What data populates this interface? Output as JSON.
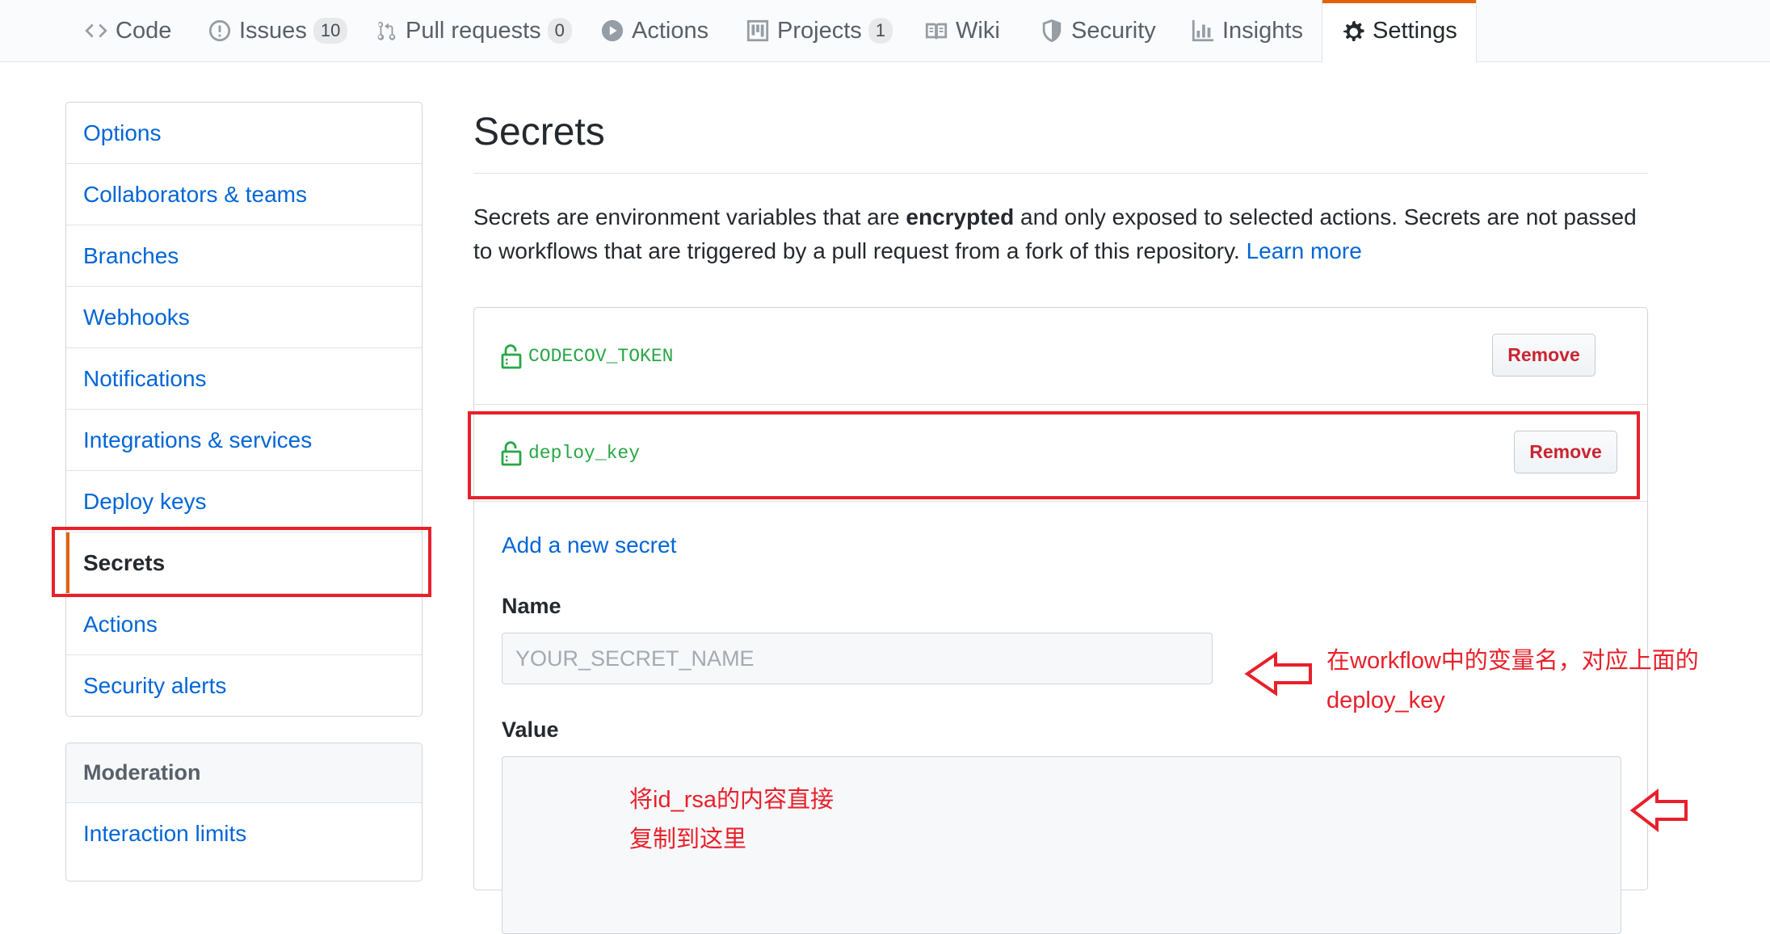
{
  "tabs": [
    {
      "label": "Code",
      "icon": "code-icon"
    },
    {
      "label": "Issues",
      "icon": "issue-icon",
      "count": "10"
    },
    {
      "label": "Pull requests",
      "icon": "pull-request-icon",
      "count": "0"
    },
    {
      "label": "Actions",
      "icon": "play-icon"
    },
    {
      "label": "Projects",
      "icon": "project-icon",
      "count": "1"
    },
    {
      "label": "Wiki",
      "icon": "book-icon"
    },
    {
      "label": "Security",
      "icon": "shield-icon"
    },
    {
      "label": "Insights",
      "icon": "graph-icon"
    },
    {
      "label": "Settings",
      "icon": "gear-icon",
      "selected": true
    }
  ],
  "sidebar": {
    "items": [
      {
        "label": "Options"
      },
      {
        "label": "Collaborators & teams"
      },
      {
        "label": "Branches"
      },
      {
        "label": "Webhooks"
      },
      {
        "label": "Notifications"
      },
      {
        "label": "Integrations & services"
      },
      {
        "label": "Deploy keys"
      },
      {
        "label": "Secrets",
        "selected": true
      },
      {
        "label": "Actions"
      },
      {
        "label": "Security alerts"
      }
    ],
    "moderation_heading": "Moderation",
    "moderation_items": [
      {
        "label": "Interaction limits"
      }
    ]
  },
  "main": {
    "title": "Secrets",
    "description_part1": "Secrets are environment variables that are ",
    "description_bold": "encrypted",
    "description_part2": " and only exposed to selected actions. Secrets are not passed to workflows that are triggered by a pull request from a fork of this repository. ",
    "learn_more": "Learn more",
    "secrets": [
      {
        "name": "CODECOV_TOKEN",
        "remove_label": "Remove"
      },
      {
        "name": "deploy_key",
        "remove_label": "Remove"
      }
    ],
    "add_secret_link": "Add a new secret",
    "name_label": "Name",
    "name_placeholder": "YOUR_SECRET_NAME",
    "value_label": "Value"
  },
  "annotations": {
    "name_note_line1": "在workflow中的变量名，对应上面的",
    "name_note_line2": "deploy_key",
    "value_note_line1": "将id_rsa的内容直接",
    "value_note_line2": "复制到这里"
  },
  "colors": {
    "link": "#0366d6",
    "accent_orange": "#e36209",
    "secret_green": "#28a745",
    "danger_red": "#cb2431",
    "annotation_red": "#e8202a"
  }
}
